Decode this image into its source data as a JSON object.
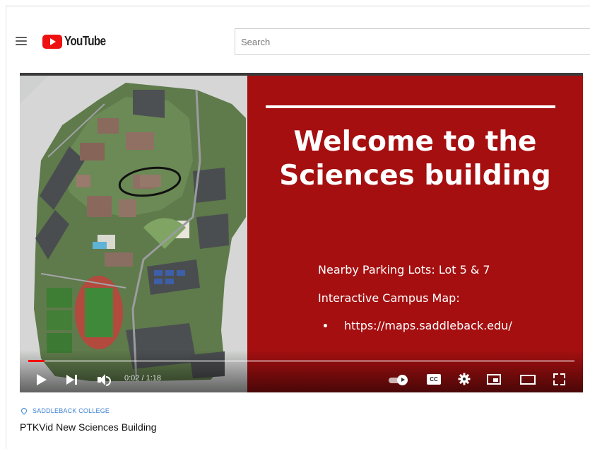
{
  "header": {
    "logo_text": "YouTube",
    "search_placeholder": "Search"
  },
  "slide": {
    "title": "Welcome to the\nSciences building",
    "parking": "Nearby Parking Lots: Lot 5 & 7",
    "map_label": "Interactive Campus Map:",
    "map_url": "https://maps.saddleback.edu/"
  },
  "player": {
    "time": "0:02 / 1:18",
    "progress": 0.03,
    "cc_label": "CC"
  },
  "video": {
    "channel": "SADDLEBACK COLLEGE",
    "title": "PTKVid New Sciences Building"
  },
  "colors": {
    "slide_background": "#a50f10",
    "progress": "#ff0000",
    "logo_red": "#ee1111",
    "channel_link": "#3e82d6"
  }
}
